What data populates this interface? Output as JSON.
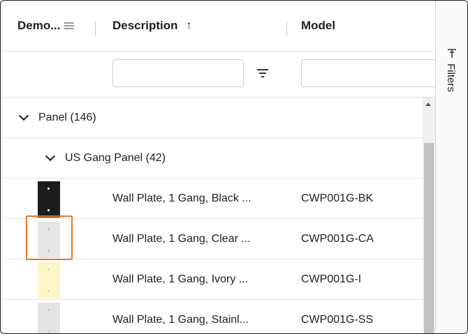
{
  "columns": [
    {
      "label": "Demo...",
      "menu_icon": "column-menu-icon"
    },
    {
      "label": "Description",
      "sort_icon": "sort-ascending-icon",
      "sort_glyph": "↑"
    },
    {
      "label": "Model"
    }
  ],
  "filters": {
    "description_value": "",
    "model_value": "",
    "filter_icon": "filter-icon"
  },
  "groups": [
    {
      "label": "Panel (146)",
      "expanded": true
    },
    {
      "label": "US Gang Panel (42)",
      "expanded": true
    }
  ],
  "rows": [
    {
      "description": "Wall Plate, 1 Gang, Black ...",
      "model": "CWP001G-BK",
      "thumb_color": "#1c1c1c",
      "dot_color": "#ffffff"
    },
    {
      "description": "Wall Plate, 1 Gang, Clear ...",
      "model": "CWP001G-CA",
      "thumb_color": "#e6e6e6",
      "dot_color": "#bdbdbd"
    },
    {
      "description": "Wall Plate, 1 Gang, Ivory ...",
      "model": "CWP001G-I",
      "thumb_color": "#fdf6c8",
      "dot_color": "#e0d9aa"
    },
    {
      "description": "Wall Plate, 1 Gang, Stainl...",
      "model": "CWP001G-SS",
      "thumb_color": "#e4e4e4",
      "dot_color": "#c4c4c4"
    }
  ],
  "side_panel": {
    "filters_label": "Filters",
    "icon": "filters-panel-icon"
  },
  "colors": {
    "highlight": "#e87722",
    "scroll_thumb": "#c1c1c1"
  }
}
